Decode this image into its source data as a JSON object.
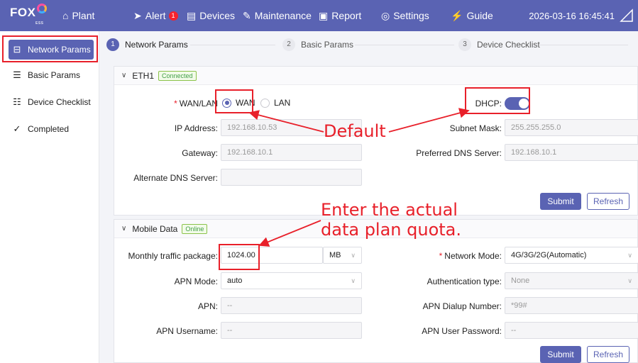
{
  "nav": {
    "logo": "FOX",
    "logo_sub": "ESS",
    "items": [
      {
        "label": "Plant",
        "icon": "home-icon"
      },
      {
        "label": "Alert",
        "icon": "bell-icon",
        "badge": "1"
      },
      {
        "label": "Devices",
        "icon": "devices-icon"
      },
      {
        "label": "Maintenance",
        "icon": "wrench-icon"
      },
      {
        "label": "Report",
        "icon": "report-icon"
      },
      {
        "label": "Settings",
        "icon": "gear-icon"
      },
      {
        "label": "Guide",
        "icon": "guide-icon"
      }
    ],
    "datetime": "2026-03-16 16:45:41"
  },
  "sidebar": {
    "items": [
      {
        "label": "Network Params",
        "icon": "network-params-icon",
        "active": true
      },
      {
        "label": "Basic Params",
        "icon": "basic-params-icon"
      },
      {
        "label": "Device Checklist",
        "icon": "checklist-icon"
      },
      {
        "label": "Completed",
        "icon": "check-circle-icon"
      }
    ]
  },
  "steps": [
    {
      "num": "1",
      "label": "Network Params",
      "active": true
    },
    {
      "num": "2",
      "label": "Basic Params"
    },
    {
      "num": "3",
      "label": "Device Checklist"
    }
  ],
  "eth1": {
    "title": "ETH1",
    "status": "Connected",
    "wan_lan_label": "WAN/LAN",
    "wan_label": "WAN",
    "lan_label": "LAN",
    "selected": "WAN",
    "dhcp_label": "DHCP",
    "dhcp_on": true,
    "ip_label": "IP Address",
    "ip_value": "192.168.10.53",
    "subnet_label": "Subnet Mask",
    "subnet_value": "255.255.255.0",
    "gateway_label": "Gateway",
    "gateway_value": "192.168.10.1",
    "dns_label": "Preferred DNS Server",
    "dns_value": "192.168.10.1",
    "alt_dns_label": "Alternate DNS Server",
    "alt_dns_value": "",
    "submit": "Submit",
    "refresh": "Refresh"
  },
  "mobile": {
    "title": "Mobile Data",
    "status": "Online",
    "traffic_label": "Monthly traffic package",
    "traffic_value": "1024.00",
    "traffic_unit": "MB",
    "network_mode_label": "Network Mode",
    "network_mode_value": "4G/3G/2G(Automatic)",
    "apn_mode_label": "APN Mode",
    "apn_mode_value": "auto",
    "auth_label": "Authentication type",
    "auth_value": "None",
    "apn_label": "APN",
    "apn_value": "--",
    "apn_dialup_label": "APN Dialup Number",
    "apn_dialup_value": "*99#",
    "apn_user_label": "APN Username",
    "apn_user_value": "--",
    "apn_pass_label": "APN User Password",
    "apn_pass_value": "--",
    "submit": "Submit",
    "refresh": "Refresh"
  },
  "annotations": {
    "default_note": "Default",
    "quota_note_line1": "Enter the actual",
    "quota_note_line2": "data plan quota."
  },
  "colors": {
    "brand": "#5a63b3",
    "highlight": "#e8202a",
    "success": "#43a047"
  }
}
